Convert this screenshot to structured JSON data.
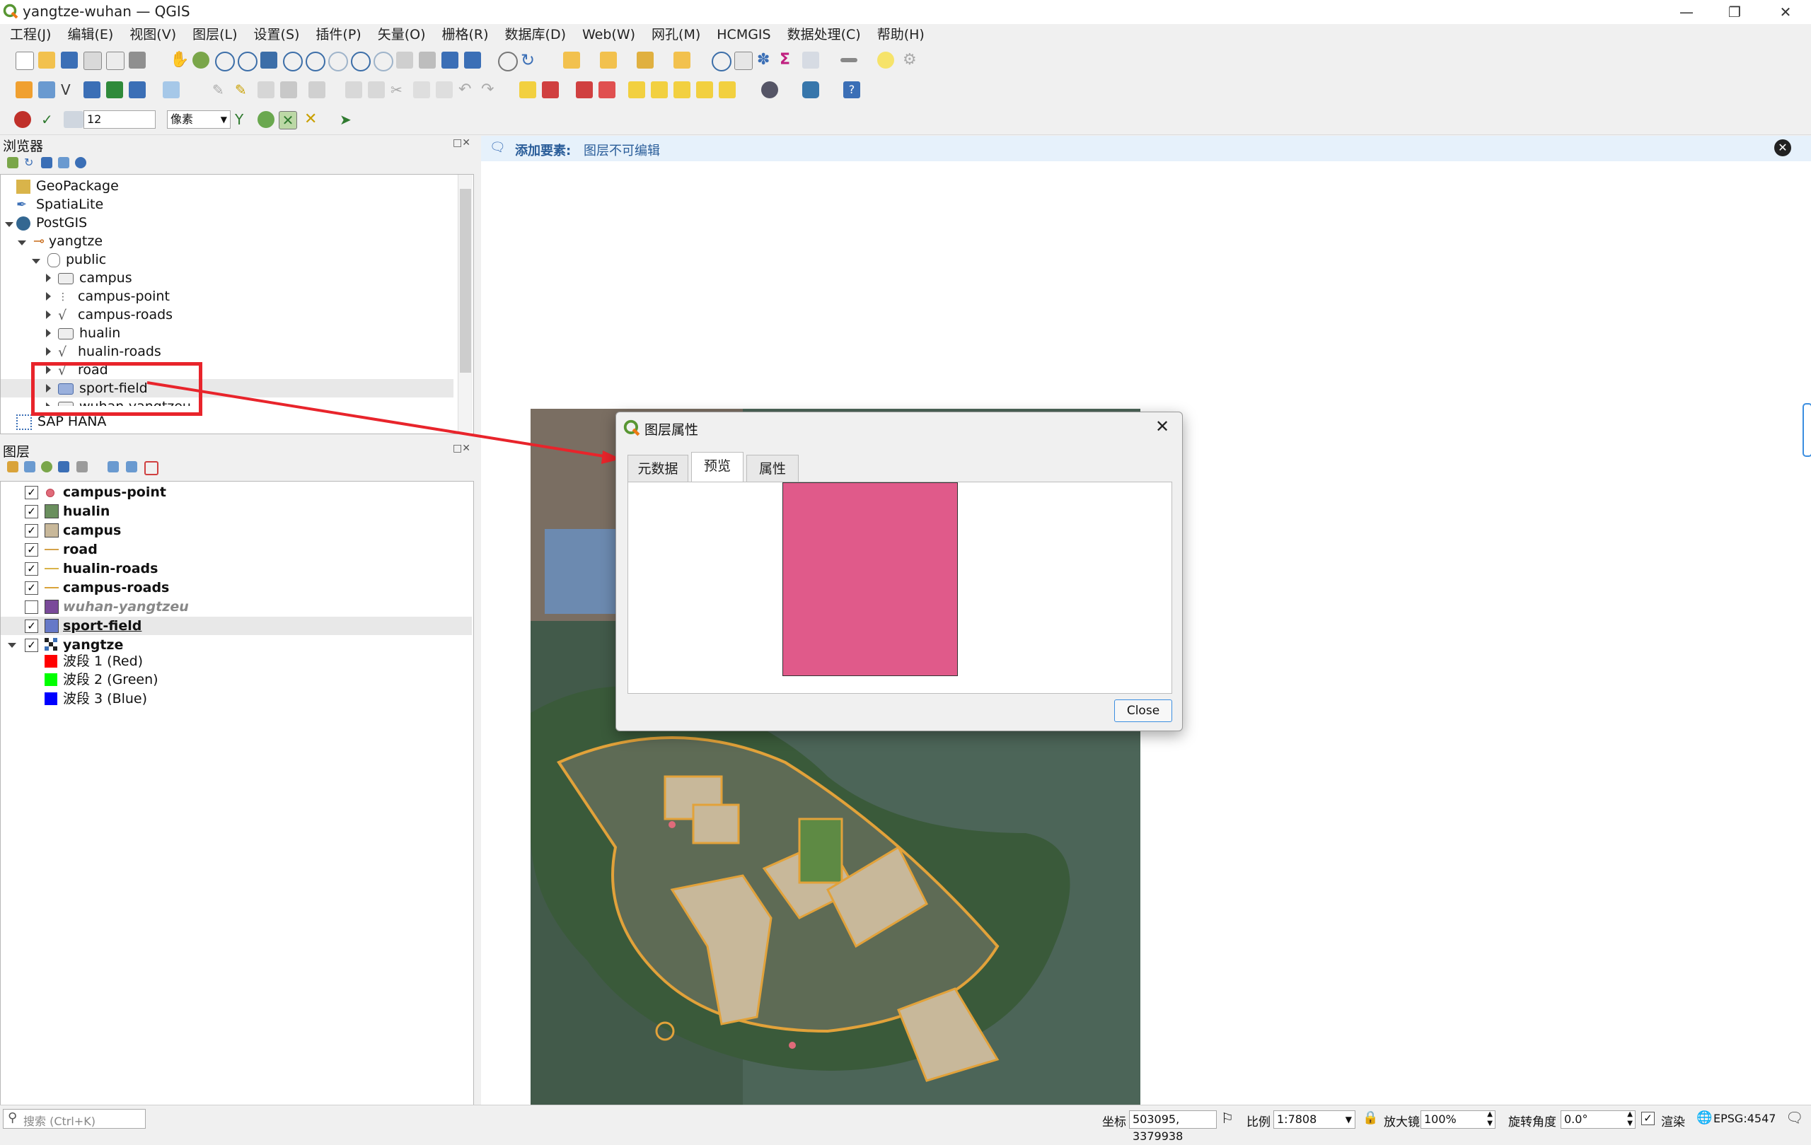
{
  "window": {
    "title": "yangtze-wuhan — QGIS"
  },
  "menus": [
    "工程(J)",
    "编辑(E)",
    "视图(V)",
    "图层(L)",
    "设置(S)",
    "插件(P)",
    "矢量(O)",
    "栅格(R)",
    "数据库(D)",
    "Web(W)",
    "网孔(M)",
    "HCMGIS",
    "数据处理(C)",
    "帮助(H)"
  ],
  "snapping": {
    "tolerance": "12",
    "unit": "像素"
  },
  "browser": {
    "title": "浏览器",
    "items": [
      {
        "label": "GeoPackage"
      },
      {
        "label": "SpatiaLite"
      },
      {
        "label": "PostGIS"
      },
      {
        "label": "yangtze"
      },
      {
        "label": "public"
      },
      {
        "label": "campus"
      },
      {
        "label": "campus-point"
      },
      {
        "label": "campus-roads"
      },
      {
        "label": "hualin"
      },
      {
        "label": "hualin-roads"
      },
      {
        "label": "road"
      },
      {
        "label": "sport-field"
      },
      {
        "label": "wuhan-yangtzeu"
      },
      {
        "label": "SAP HANA"
      }
    ]
  },
  "layers": {
    "title": "图层",
    "items": [
      {
        "label": "campus-point",
        "checked": true,
        "color": "#e06b7a"
      },
      {
        "label": "hualin",
        "checked": true,
        "color": "#6a8f5e"
      },
      {
        "label": "campus",
        "checked": true,
        "color": "#c8b89a"
      },
      {
        "label": "road",
        "checked": true,
        "color": "#d4a24a"
      },
      {
        "label": "hualin-roads",
        "checked": true,
        "color": "#d9b34a"
      },
      {
        "label": "campus-roads",
        "checked": true,
        "color": "#d9a33a"
      },
      {
        "label": "wuhan-yangtzeu",
        "checked": false,
        "color": "#7a4a9a"
      },
      {
        "label": "sport-field",
        "checked": true,
        "color": "#6679c8"
      },
      {
        "label": "yangtze",
        "checked": true
      }
    ],
    "bands": [
      {
        "label": "波段 1 (Red)",
        "color": "#ff0000"
      },
      {
        "label": "波段 2 (Green)",
        "color": "#00ff00"
      },
      {
        "label": "波段 3 (Blue)",
        "color": "#0000ff"
      }
    ]
  },
  "message": {
    "label": "添加要素:",
    "text": "图层不可编辑"
  },
  "dialog": {
    "title": "图层属性",
    "tabs": [
      "元数据",
      "预览",
      "属性"
    ],
    "preview_color": "#e05a8a",
    "close": "Close"
  },
  "search": {
    "placeholder": "搜索 (Ctrl+K)"
  },
  "status": {
    "coord_label": "坐标",
    "coord": "503095, 3379938",
    "scale_label": "比例",
    "scale": "1:7808",
    "magnifier_label": "放大镜",
    "magnifier": "100%",
    "rotation_label": "旋转角度",
    "rotation": "0.0°",
    "render_label": "渲染",
    "crs": "EPSG:4547"
  }
}
